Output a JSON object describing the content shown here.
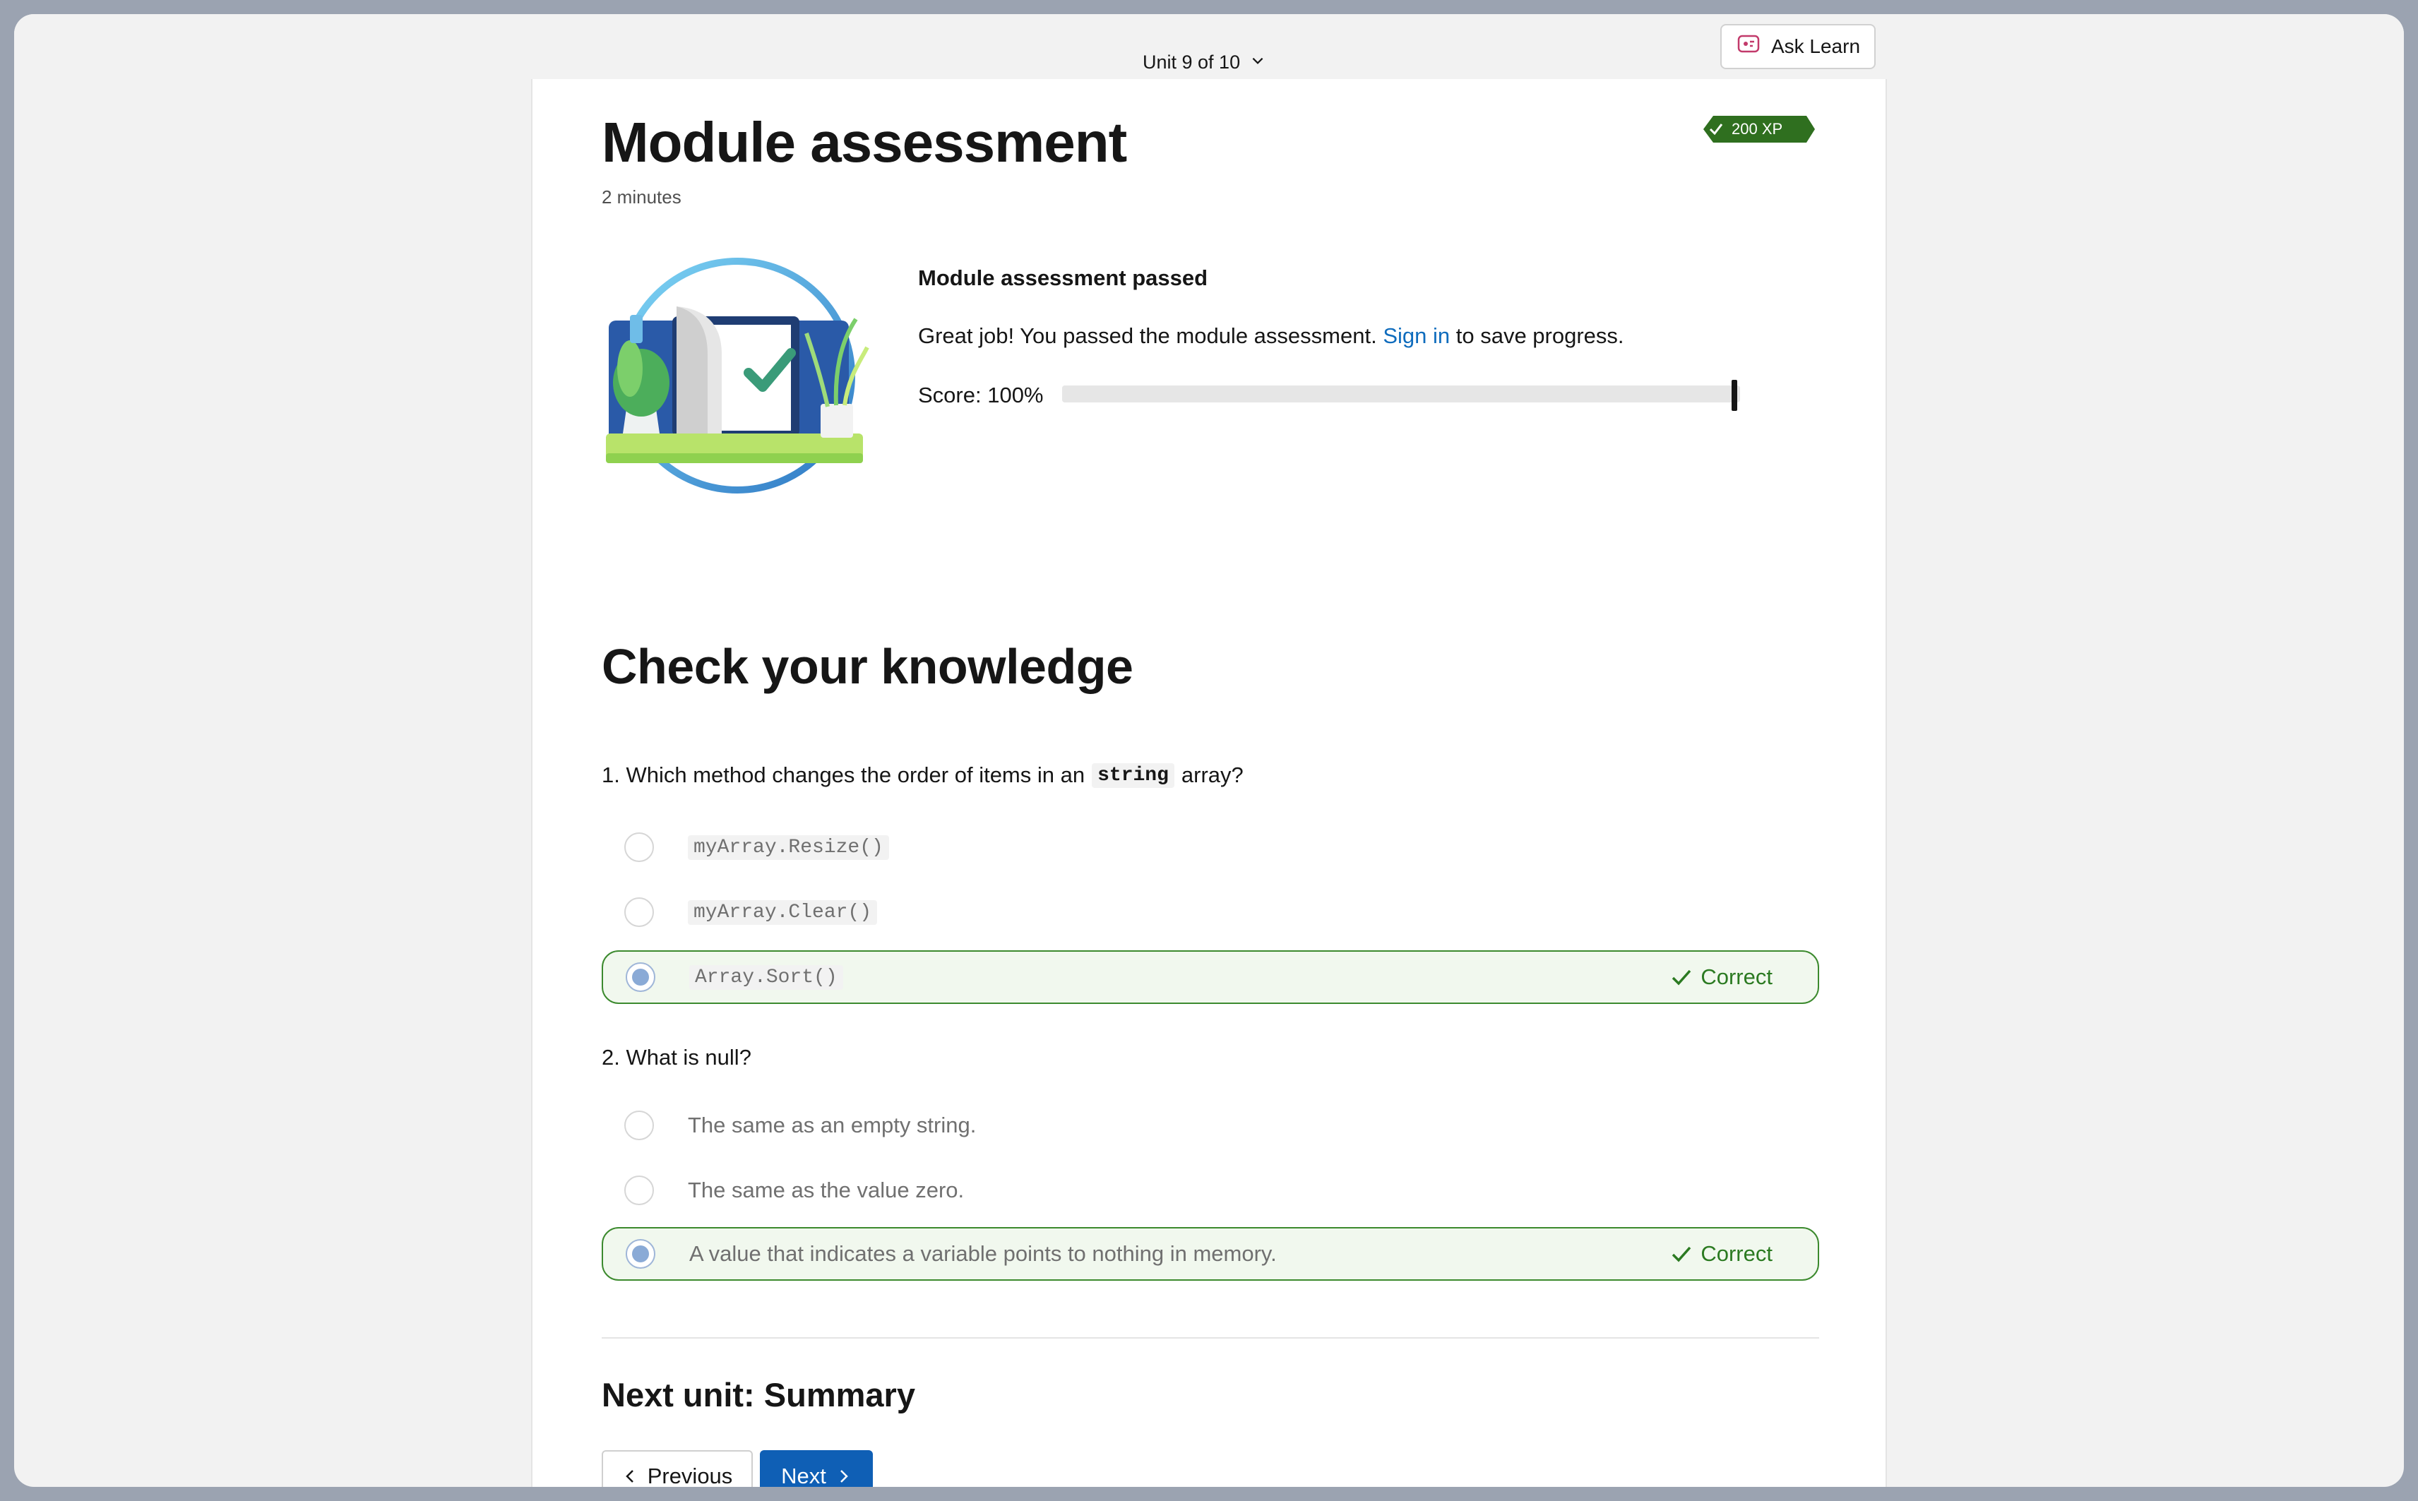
{
  "topbar": {
    "unit_label": "Unit 9 of 10",
    "ask_learn_label": "Ask Learn"
  },
  "page": {
    "title": "Module assessment",
    "duration": "2 minutes",
    "xp": "200 XP"
  },
  "result": {
    "title": "Module assessment passed",
    "message_before": "Great job! You passed the module assessment.",
    "sign_in_link": "Sign in",
    "message_after": "to save progress.",
    "score_label": "Score: 100%",
    "score_value": 1.0
  },
  "quiz": {
    "section_title": "Check your knowledge",
    "questions": [
      {
        "prefix": "1. Which method changes the order of items in an",
        "code": "string",
        "suffix": "array?",
        "options": [
          {
            "label": "myArray.Resize()",
            "selected": false
          },
          {
            "label": "myArray.Clear()",
            "selected": false
          },
          {
            "label": "Array.Sort()",
            "selected": true,
            "feedback": "Correct"
          }
        ]
      },
      {
        "prefix": "2. What is null?",
        "options": [
          {
            "label": "The same as an empty string.",
            "selected": false
          },
          {
            "label": "The same as the value zero.",
            "selected": false
          },
          {
            "label": "A value that indicates a variable points to nothing in memory.",
            "selected": true,
            "feedback": "Correct"
          }
        ]
      }
    ]
  },
  "footer": {
    "next_unit": "Next unit: Summary",
    "previous_label": "Previous",
    "next_label": "Next"
  },
  "colors": {
    "accent": "#0f6cbd",
    "correct": "#2b7a21",
    "xp_badge": "#2f6f1f"
  }
}
